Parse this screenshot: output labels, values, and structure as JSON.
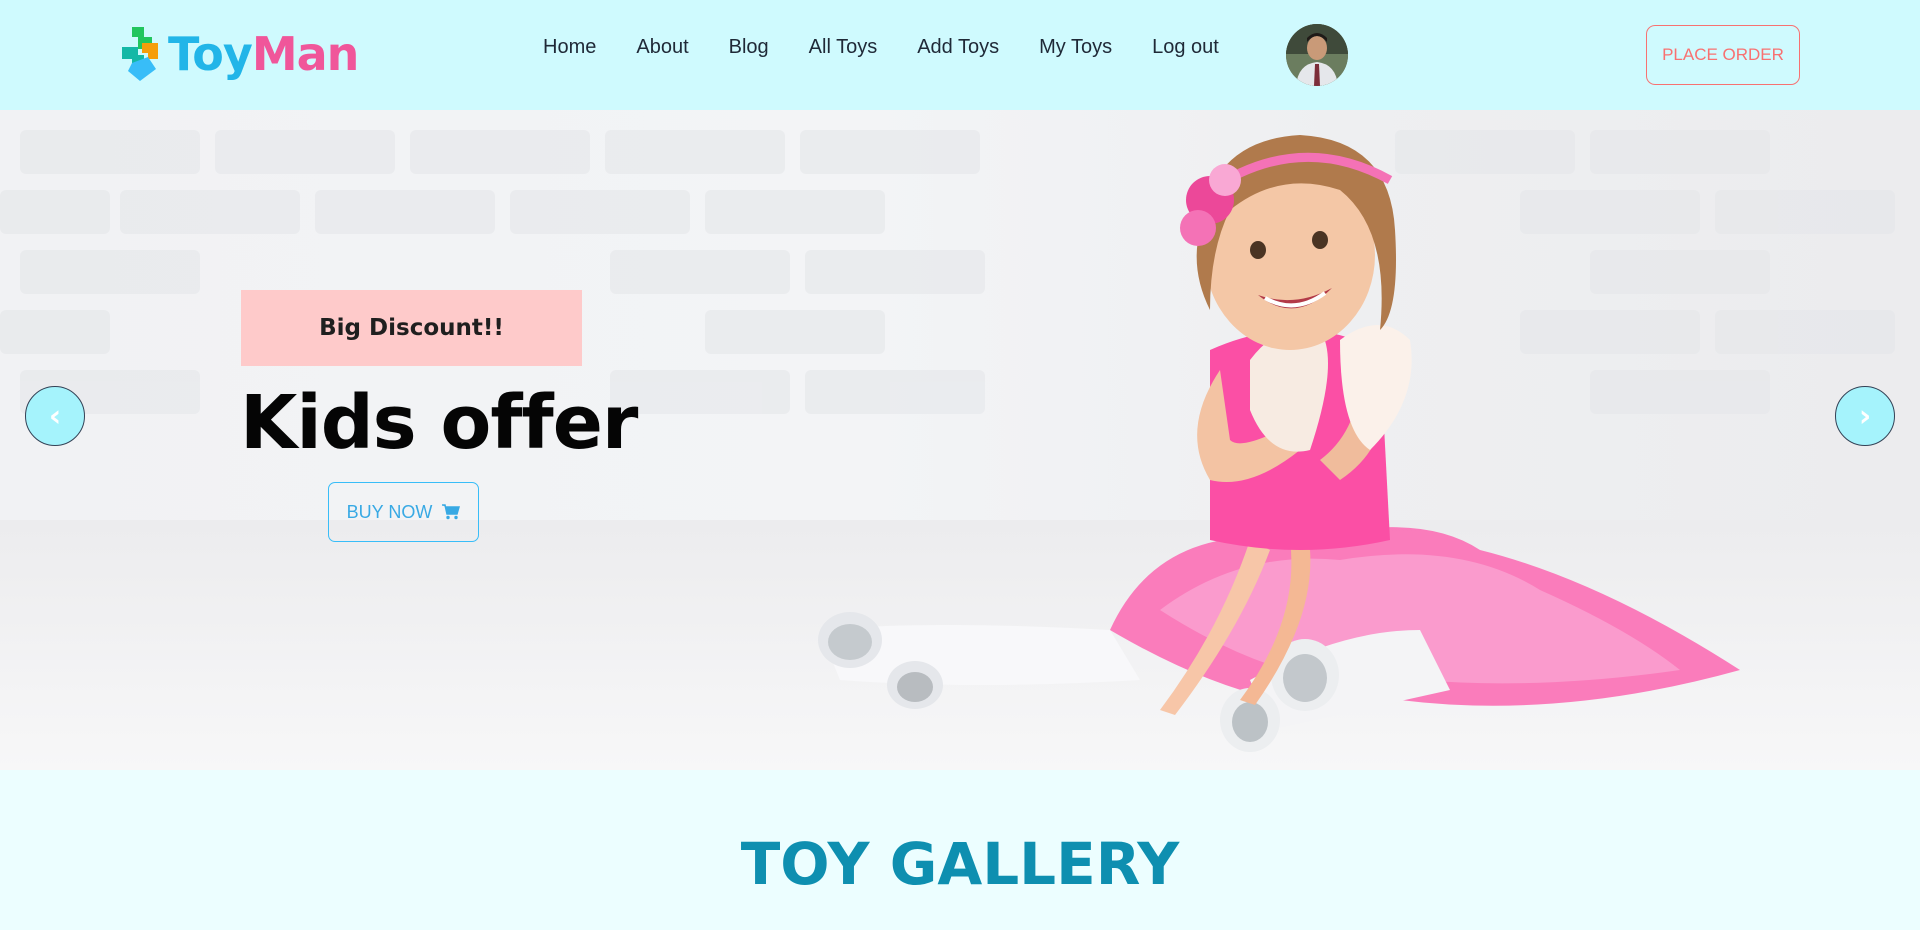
{
  "brand": {
    "part1": "Toy",
    "part2": "Man"
  },
  "nav": {
    "links": [
      {
        "label": "Home"
      },
      {
        "label": "About"
      },
      {
        "label": "Blog"
      },
      {
        "label": "All Toys"
      },
      {
        "label": "Add Toys"
      },
      {
        "label": "My Toys"
      },
      {
        "label": "Log out"
      }
    ],
    "cta": "PLACE ORDER"
  },
  "hero": {
    "badge": "Big Discount!!",
    "title": "Kids offer",
    "button": "BUY NOW",
    "button_icon": "cart-icon",
    "prev": "‹",
    "next": "›"
  },
  "gallery": {
    "title": "TOY GALLERY"
  },
  "colors": {
    "nav_bg": "#cffafe",
    "brand_toy": "#22b5e8",
    "brand_man": "#f0569a",
    "place_order": "#f87171",
    "badge_bg": "#fecaca",
    "buy_now": "#38bdf8",
    "arrow_bg": "#a5f3fc",
    "gallery_title": "#0e8fb0"
  }
}
